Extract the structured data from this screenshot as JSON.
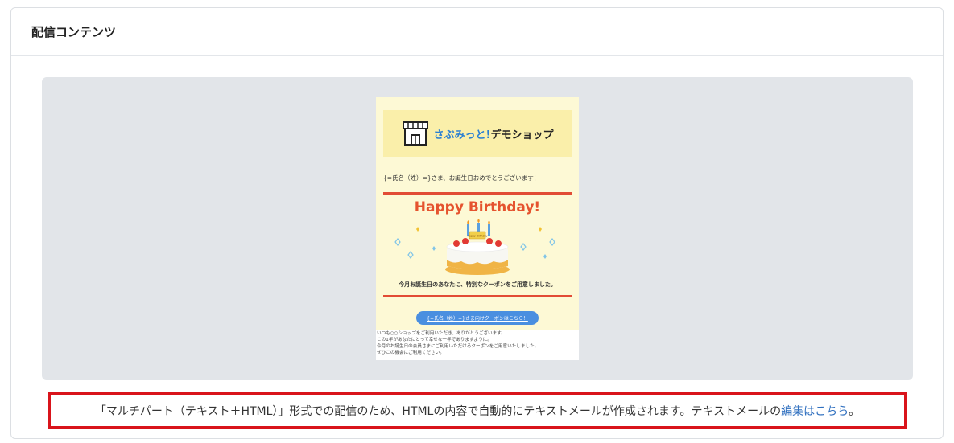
{
  "section": {
    "title": "配信コンテンツ"
  },
  "email_preview": {
    "logo_text_blue": "さぶみっと!",
    "logo_text_dark": "デモショップ",
    "greeting": "{=氏名（姓）=}さま、お誕生日おめでとうございます！",
    "headline": "Happy Birthday!",
    "cake_plate_text": "Happy Birthday",
    "message": "今月お誕生日のあなたに、特別なクーポンをご用意しました。",
    "coupon_button": "{=氏名（姓）=}さま向けクーポンはこちら！",
    "body_lines": [
      "いつも○○ショップをご利用いただき、ありがとうございます。",
      "この1年があなたにとって幸せな一年でありますように。",
      "今月のお誕生日の会員さまにご利用いただけるクーポンをご用意いたしました。",
      "ぜひこの機会にご利用ください。"
    ]
  },
  "notice": {
    "text": "「マルチパート（テキスト＋HTML）」形式での配信のため、HTMLの内容で自動的にテキストメールが作成されます。テキストメールの",
    "link": "編集はこちら",
    "suffix": "。"
  },
  "colors": {
    "highlight_border": "#d9141b",
    "link": "#2f6fbf",
    "email_accent_red": "#e24c35",
    "button_blue": "#4a8fe0"
  }
}
